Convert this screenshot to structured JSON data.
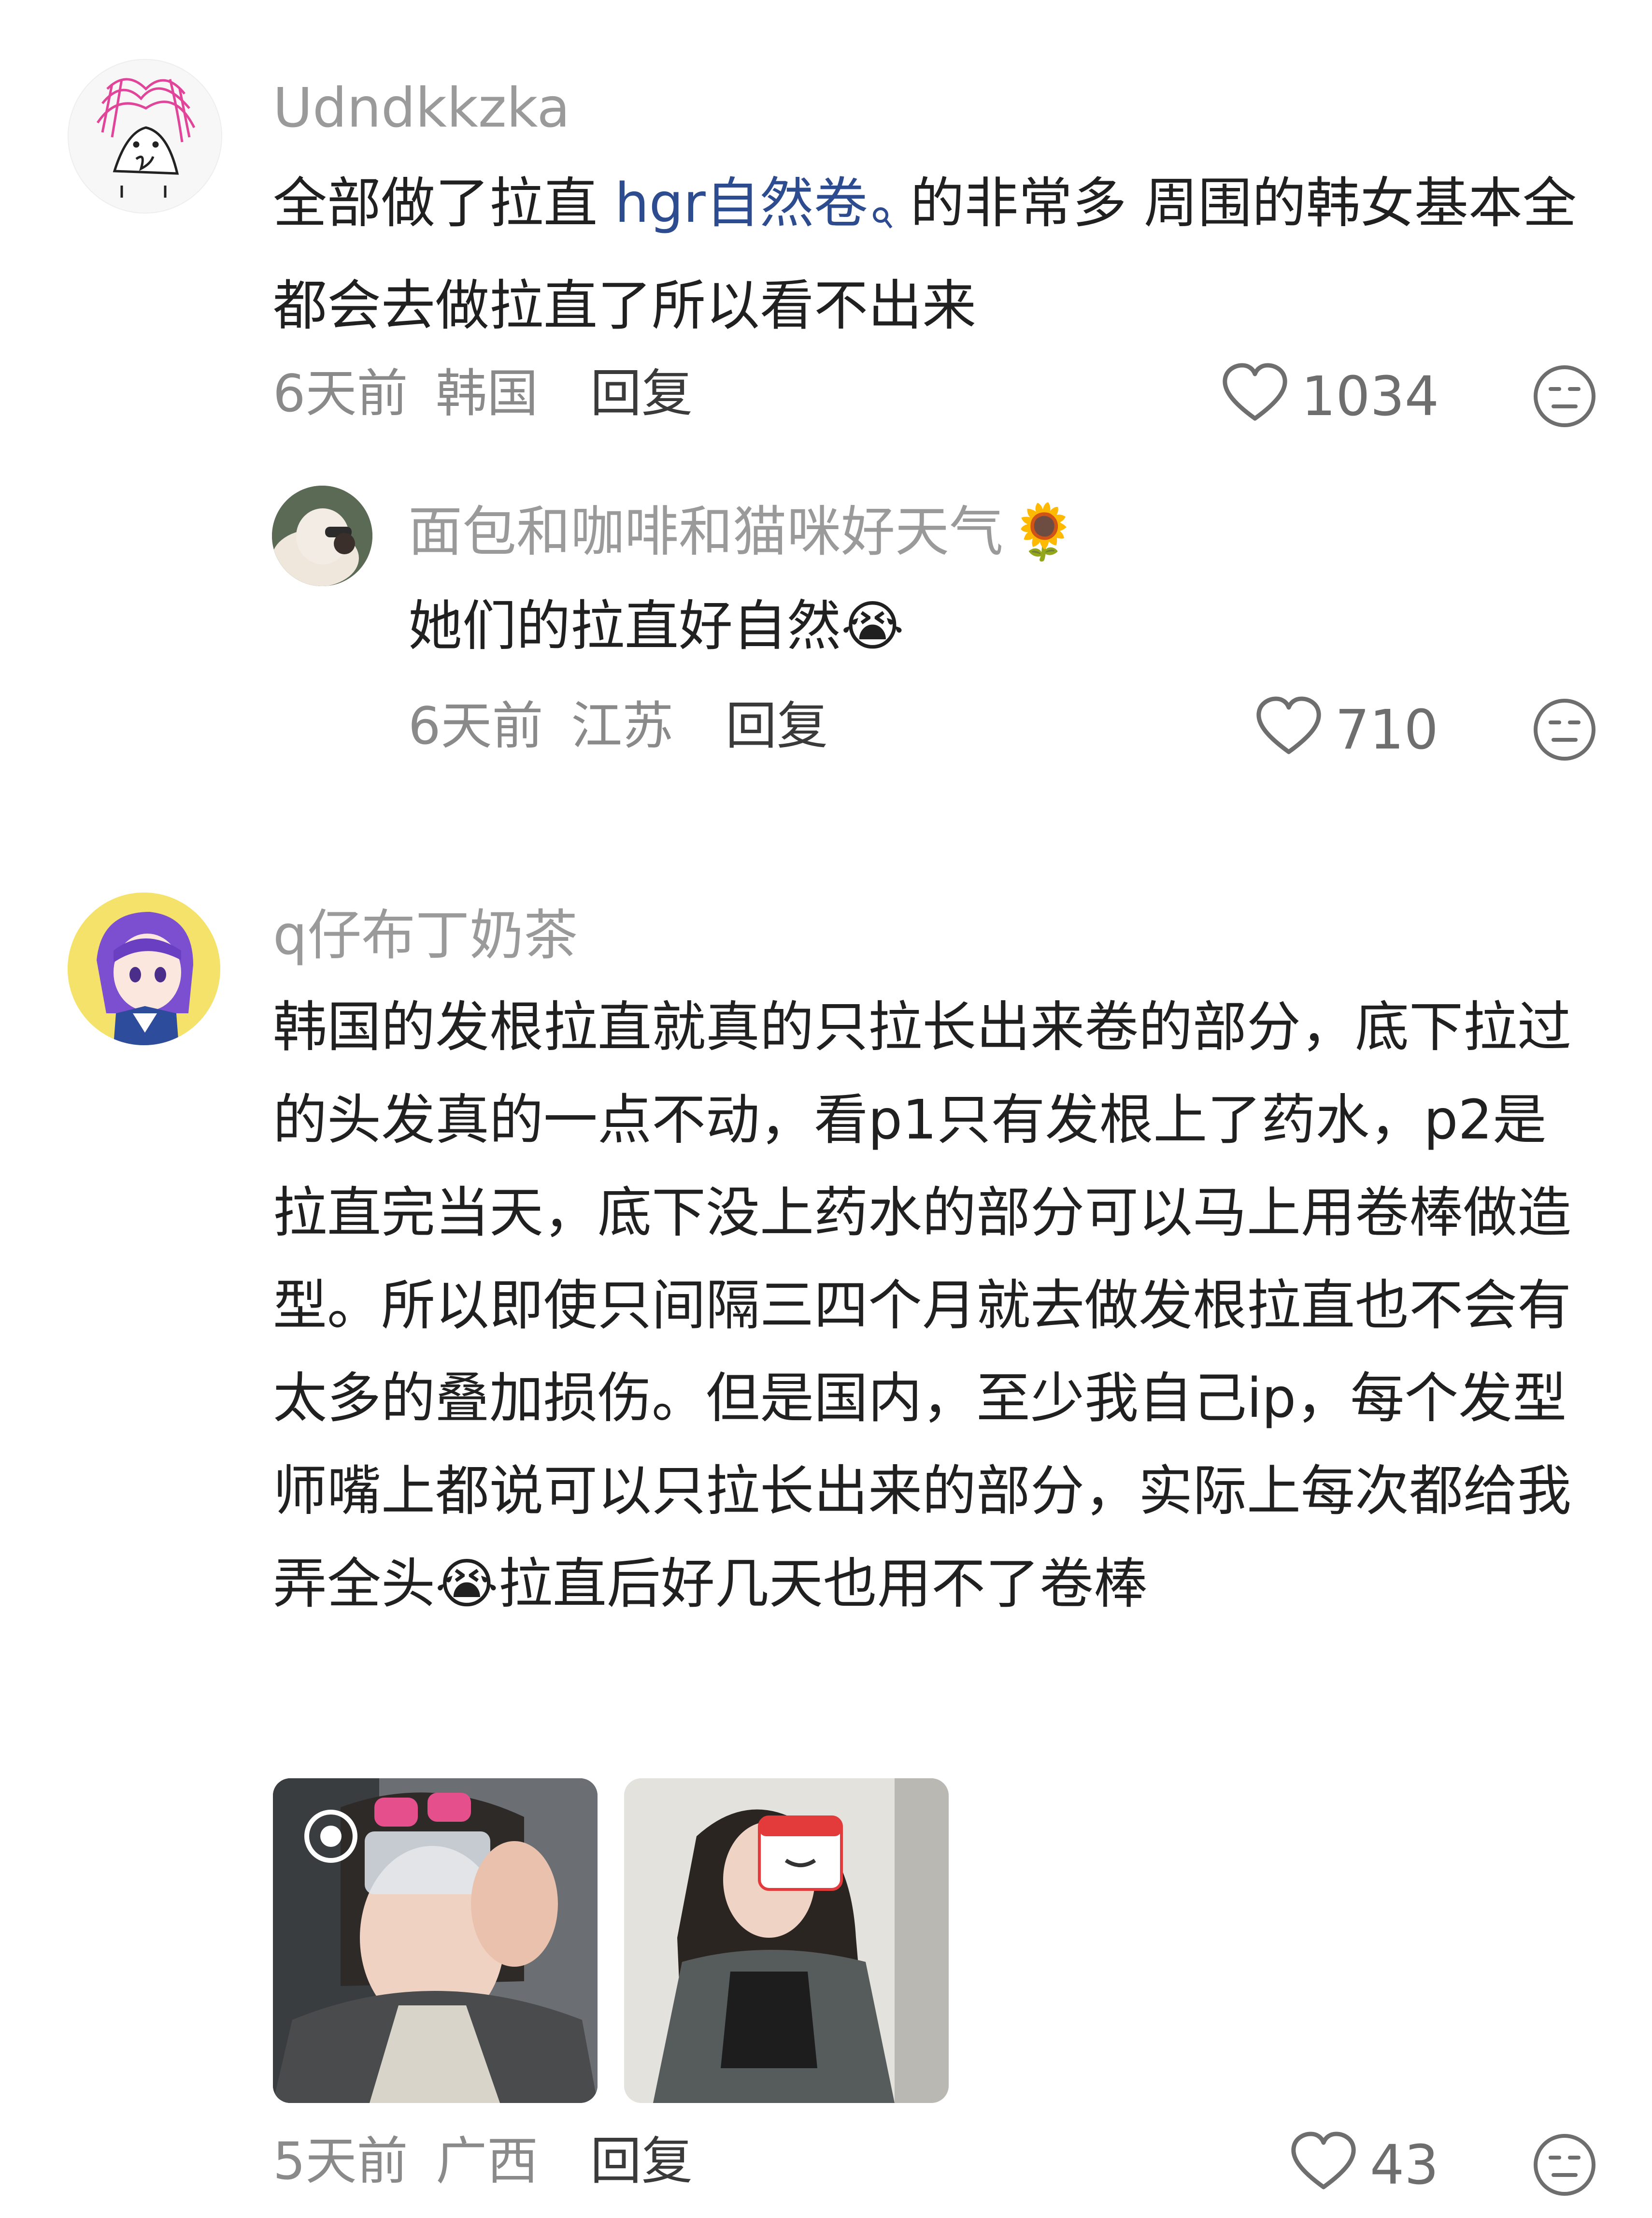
{
  "comments": [
    {
      "username": "Udndkkzka",
      "text_before": "全部做了拉直 ",
      "link_text": "hgr自然卷",
      "text_after": " 的非常多 周围的韩女基本全都会去做拉直了所以看不出来",
      "time": "6天前",
      "location": "韩国",
      "reply_label": "回复",
      "likes": "1034",
      "replies": [
        {
          "username": "面包和咖啡和猫咪好天气",
          "name_emoji": "🌻",
          "text": "她们的拉直好自然",
          "text_emoji": "😭",
          "time": "6天前",
          "location": "江苏",
          "reply_label": "回复",
          "likes": "710"
        }
      ]
    },
    {
      "username": "q仔布丁奶茶",
      "text_part1": "韩国的发根拉直就真的只拉长出来卷的部分，底下拉过的头发真的一点不动，看p1只有发根上了药水，p2是拉直完当天，底下没上药水的部分可以马上用卷棒做造型。所以即使只间隔三四个月就去做发根拉直也不会有太多的叠加损伤。但是国内，至少我自己ip，每个发型师嘴上都说可以只拉长出来的部分，实际上每次都给我弄全头",
      "inline_emoji": "😭",
      "text_part2": "拉直后好几天也用不了卷棒",
      "time": "5天前",
      "location": "广西",
      "reply_label": "回复",
      "likes": "43"
    }
  ],
  "icons": {
    "like": "heart-outline-icon",
    "dislike": "meh-face-icon",
    "search": "search-icon"
  },
  "colors": {
    "link": "#2d4c8f",
    "username": "#9a9a9a",
    "meta": "#8a8a8a"
  }
}
